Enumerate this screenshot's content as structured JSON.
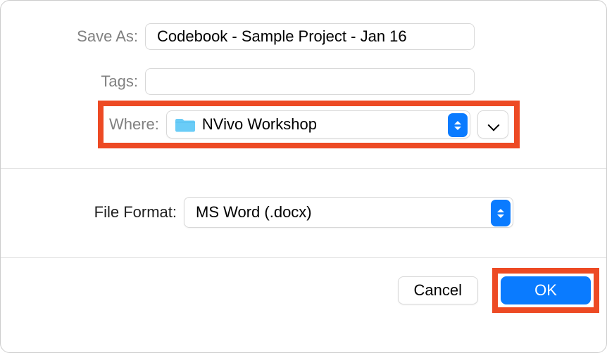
{
  "labels": {
    "saveAs": "Save As:",
    "tags": "Tags:",
    "where": "Where:",
    "fileFormat": "File Format:"
  },
  "values": {
    "filename": "Codebook - Sample Project - Jan 16",
    "tags": "",
    "location": "NVivo Workshop",
    "fileFormat": "MS Word (.docx)"
  },
  "buttons": {
    "cancel": "Cancel",
    "ok": "OK"
  }
}
